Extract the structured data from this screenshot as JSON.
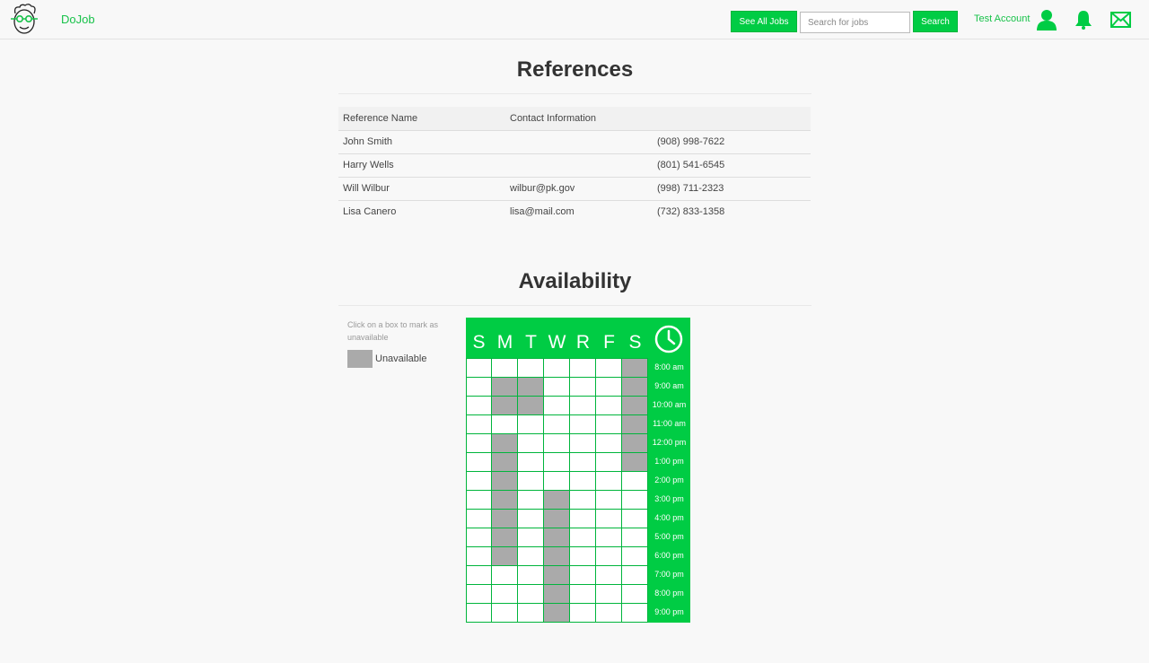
{
  "nav": {
    "brand": "DoJob",
    "see_all_label": "See All Jobs",
    "search_placeholder": "Search for jobs",
    "search_label": "Search",
    "account_label": "Test Account",
    "icons": [
      "user-icon",
      "bell-icon",
      "mail-icon"
    ]
  },
  "references": {
    "title": "References",
    "headers": [
      "Reference Name",
      "Contact Information",
      ""
    ],
    "rows": [
      [
        "John Smith",
        "",
        "(908) 998-7622"
      ],
      [
        "Harry Wells",
        "",
        "(801) 541-6545"
      ],
      [
        "Will Wilbur",
        "wilbur@pk.gov",
        "(998) 711-2323"
      ],
      [
        "Lisa Canero",
        "lisa@mail.com",
        "(732) 833-1358"
      ]
    ]
  },
  "availability": {
    "title": "Availability",
    "hint": "Click on a box to mark as unavailable",
    "legend_label": "Unavailable",
    "days": [
      "S",
      "M",
      "T",
      "W",
      "R",
      "F",
      "S"
    ],
    "times": [
      "8:00 am",
      "9:00 am",
      "10:00 am",
      "11:00 am",
      "12:00 pm",
      "1:00 pm",
      "2:00 pm",
      "3:00 pm",
      "4:00 pm",
      "5:00 pm",
      "6:00 pm",
      "7:00 pm",
      "8:00 pm",
      "9:00 pm"
    ],
    "unavailable": [
      [
        0,
        0,
        0,
        0,
        0,
        0,
        1
      ],
      [
        0,
        1,
        1,
        0,
        0,
        0,
        1
      ],
      [
        0,
        1,
        1,
        0,
        0,
        0,
        1
      ],
      [
        0,
        0,
        0,
        0,
        0,
        0,
        1
      ],
      [
        0,
        1,
        0,
        0,
        0,
        0,
        1
      ],
      [
        0,
        1,
        0,
        0,
        0,
        0,
        1
      ],
      [
        0,
        1,
        0,
        0,
        0,
        0,
        0
      ],
      [
        0,
        1,
        0,
        1,
        0,
        0,
        0
      ],
      [
        0,
        1,
        0,
        1,
        0,
        0,
        0
      ],
      [
        0,
        1,
        0,
        1,
        0,
        0,
        0
      ],
      [
        0,
        1,
        0,
        1,
        0,
        0,
        0
      ],
      [
        0,
        0,
        0,
        1,
        0,
        0,
        0
      ],
      [
        0,
        0,
        0,
        1,
        0,
        0,
        0
      ],
      [
        0,
        0,
        0,
        1,
        0,
        0,
        0
      ]
    ],
    "colors": {
      "accent": "#00cc44",
      "unavailable": "#aaaaaa"
    }
  }
}
